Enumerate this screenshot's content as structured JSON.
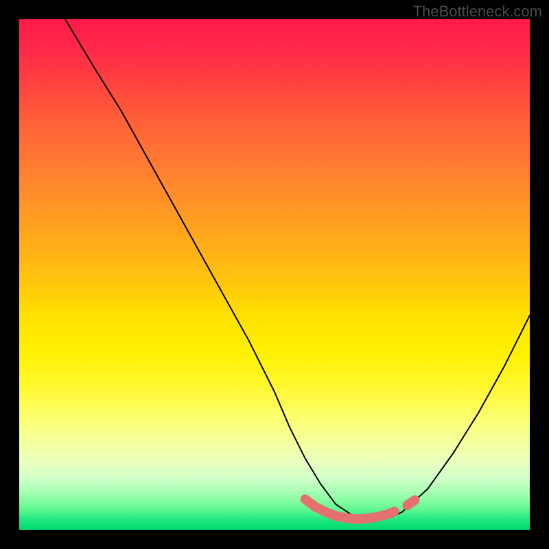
{
  "watermark": "TheBottleneck.com",
  "chart_data": {
    "type": "line",
    "title": "",
    "xlabel": "",
    "ylabel": "",
    "xlim": [
      0,
      100
    ],
    "ylim": [
      0,
      100
    ],
    "grid": false,
    "legend": false,
    "series": [
      {
        "name": "bottleneck-curve",
        "x": [
          9,
          15,
          20,
          25,
          30,
          35,
          40,
          45,
          50,
          53,
          56,
          59,
          62,
          65,
          68,
          71,
          73,
          75,
          80,
          85,
          90,
          95,
          100
        ],
        "values": [
          100,
          90,
          82,
          73,
          64,
          55,
          46,
          37,
          27,
          20,
          14,
          9,
          5,
          3,
          2,
          2,
          2.5,
          3.5,
          8,
          15,
          23,
          32,
          42
        ]
      },
      {
        "name": "optimal-zone-marker",
        "x": [
          56,
          58,
          60,
          62,
          64,
          66,
          68,
          70,
          72,
          73.5
        ],
        "values": [
          6,
          4.5,
          3.5,
          2.7,
          2.3,
          2.1,
          2.2,
          2.5,
          3.0,
          3.6
        ]
      },
      {
        "name": "optimal-zone-marker-right",
        "x": [
          76,
          77.5
        ],
        "values": [
          4.8,
          5.8
        ]
      }
    ],
    "gradient_stops": [
      {
        "pos": 0,
        "color": "#ff1a4a"
      },
      {
        "pos": 50,
        "color": "#ffe000"
      },
      {
        "pos": 100,
        "color": "#00d870"
      }
    ]
  }
}
